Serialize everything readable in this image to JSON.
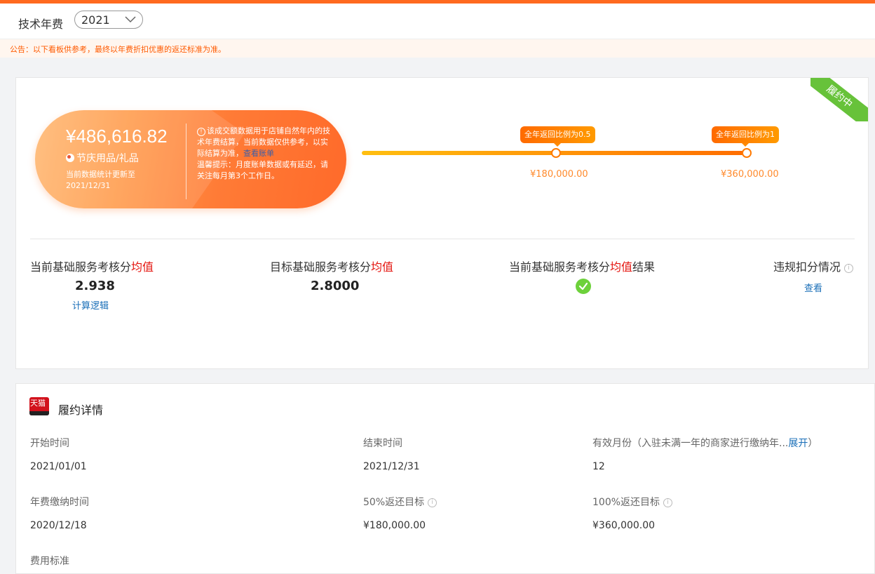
{
  "header": {
    "title": "技术年费",
    "year": "2021"
  },
  "notice": "公告：以下看板供参考，最终以年费折扣优惠的返还标准为准。",
  "status_ribbon": "履约中",
  "summary": {
    "amount": "¥486,616.82",
    "category": "节庆用品/礼品",
    "update_line1": "当前数据统计更新至",
    "update_line2": "2021/12/31",
    "desc_text": "该成交额数据用于店铺自然年内的技术年费结算，当前数据仅供参考，以实际结算为准，",
    "desc_link": "查看账单",
    "desc_tip": "温馨提示：月度账单数据或有延迟，请关注每月第3个工作日。"
  },
  "progress": {
    "levels": [
      {
        "tag": "全年返回比例为0.5",
        "value": "¥180,000.00"
      },
      {
        "tag": "全年返回比例为1",
        "value": "¥360,000.00"
      }
    ]
  },
  "stats": {
    "current_label_pre": "当前基础服务考核分",
    "current_label_red": "均值",
    "current_value": "2.938",
    "current_link": "计算逻辑",
    "target_label_pre": "目标基础服务考核分",
    "target_label_red": "均值",
    "target_value": "2.8000",
    "result_label_pre": "当前基础服务考核分",
    "result_label_red": "均值",
    "result_label_post": "结果",
    "penalty_label": "违规扣分情况",
    "penalty_link": "查看"
  },
  "details": {
    "tmall_logo_text": "天猫",
    "title": "履约详情",
    "start_label": "开始时间",
    "start_value": "2021/01/01",
    "end_label": "结束时间",
    "end_value": "2021/12/31",
    "months_label": "有效月份（入驻未满一年的商家进行缴纳年...",
    "months_expand": "展开",
    "months_close": "）",
    "months_value": "12",
    "pay_label": "年费缴纳时间",
    "pay_value": "2020/12/18",
    "target50_label": "50%返还目标",
    "target50_value": "¥180,000.00",
    "target100_label": "100%返还目标",
    "target100_value": "¥360,000.00",
    "fee_label": "费用标准"
  },
  "colors": {
    "brand_orange": "#ff6a1f",
    "highlight_red": "#e4140e",
    "link_blue": "#1a6fb8",
    "success_green": "#6dd13b"
  }
}
